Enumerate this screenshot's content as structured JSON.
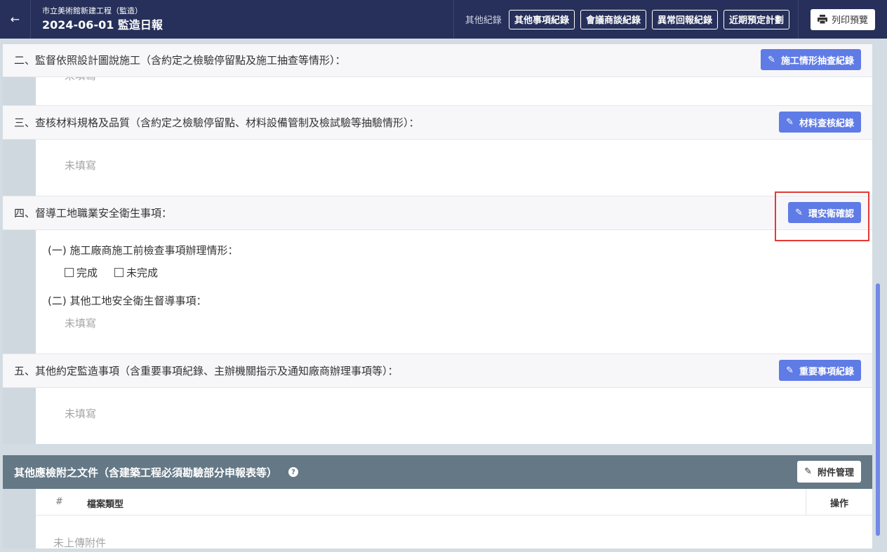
{
  "header": {
    "back_icon": "←",
    "subtitle": "市立美術館新建工程（監造）",
    "title": "2024-06-01 監造日報",
    "records_label": "其他紀錄",
    "record_buttons": [
      "其他事項紀錄",
      "會議商談紀錄",
      "異常回報紀錄",
      "近期預定計劃"
    ],
    "print_label": "列印預覽"
  },
  "sections": {
    "s2": {
      "title": "二、監督依照設計圖說施工（含約定之檢驗停留點及施工抽查等情形）：",
      "button": "施工情形抽查紀錄",
      "body": "未填寫"
    },
    "s3": {
      "title": "三、查核材料規格及品質（含約定之檢驗停留點、材料設備管制及檢試驗等抽驗情形）：",
      "button": "材料查核紀錄",
      "body": "未填寫"
    },
    "s4": {
      "title": "四、督導工地職業安全衛生事項：",
      "button": "環安衛確認",
      "q1": "(一) 施工廠商施工前檢查事項辦理情形：",
      "opt_done": "完成",
      "opt_undone": "未完成",
      "q2": "(二) 其他工地安全衛生督導事項：",
      "q2_body": "未填寫"
    },
    "s5": {
      "title": "五、其他約定監造事項（含重要事項紀錄、主辦機關指示及通知廠商辦理事項等）：",
      "button": "重要事項紀錄",
      "body": "未填寫"
    }
  },
  "attachments": {
    "title": "其他應檢附之文件（含建築工程必須勘驗部分申報表等）",
    "help_icon": "?",
    "button": "附件管理",
    "columns": {
      "num": "#",
      "type": "檔案類型",
      "ops": "操作"
    },
    "empty": "未上傳附件"
  },
  "colors": {
    "header_bg": "#26305a",
    "accent": "#5f7be6",
    "attach_header_bg": "#647886",
    "highlight": "#e53935"
  }
}
